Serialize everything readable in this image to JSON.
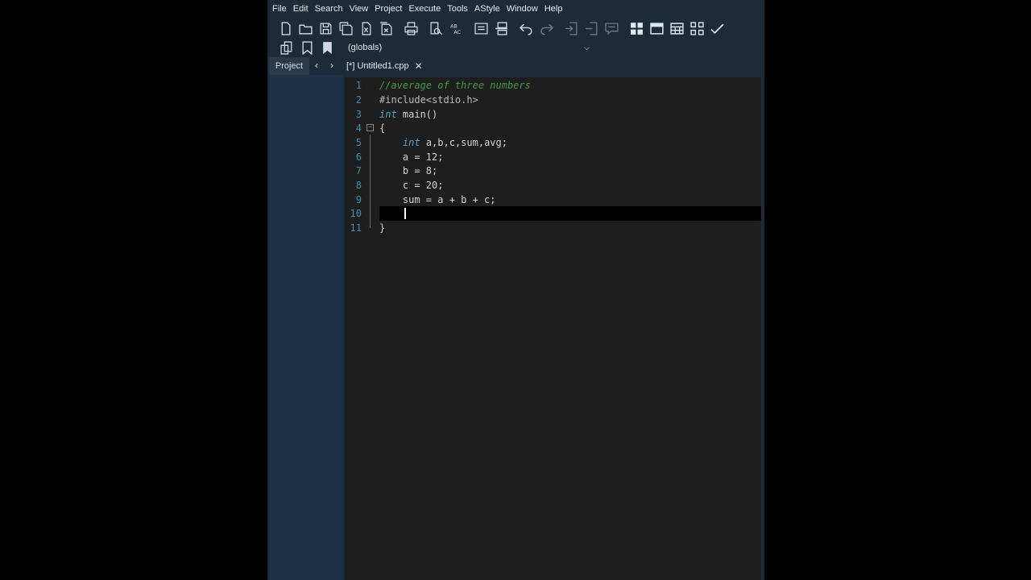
{
  "menu": [
    "File",
    "Edit",
    "Search",
    "View",
    "Project",
    "Execute",
    "Tools",
    "AStyle",
    "Window",
    "Help"
  ],
  "toolbar1_icons": [
    "new-file-icon",
    "open-folder-icon",
    "save-icon",
    "save-all-icon",
    "close-file-icon",
    "close-all-icon",
    "print-icon",
    "find-icon",
    "spell-check-icon",
    "indent-icon",
    "unindent-icon",
    "undo-icon",
    "redo-icon",
    "goto-definition-icon",
    "goto-declaration-icon",
    "comment-icon",
    "layout-grid-icon",
    "layout-window-icon",
    "layout-split-icon",
    "layout-tiles-icon",
    "check-icon"
  ],
  "toolbar2": {
    "icons": [
      "class-browser-icon",
      "bookmark-icon",
      "bookmark-list-icon"
    ],
    "scope_value": "(globals)"
  },
  "tabs": {
    "project_label": "Project",
    "prev_arrow": "‹",
    "next_arrow": "›",
    "file_label": "[*] Untitled1.cpp",
    "close_glyph": "✕"
  },
  "editor": {
    "lines": [
      {
        "num": "1",
        "text": "//average of three numbers"
      },
      {
        "num": "2",
        "text": "#include<stdio.h>"
      },
      {
        "num": "3",
        "text": "int main()"
      },
      {
        "num": "4",
        "text": "{"
      },
      {
        "num": "5",
        "text": "    int a,b,c,sum,avg;"
      },
      {
        "num": "6",
        "text": "    a = 12;"
      },
      {
        "num": "7",
        "text": "    b = 8;"
      },
      {
        "num": "8",
        "text": "    c = 20;"
      },
      {
        "num": "9",
        "text": "    sum = a + b + c;"
      },
      {
        "num": "10",
        "text": ""
      },
      {
        "num": "11",
        "text": "}"
      }
    ],
    "current_line": 10
  },
  "colors": {
    "app_bg": "#1d2a38",
    "editor_bg": "#1e1e1e",
    "comment": "#3d9b3d",
    "keyword": "#4ea0d6",
    "line_number": "#3a8db5"
  }
}
